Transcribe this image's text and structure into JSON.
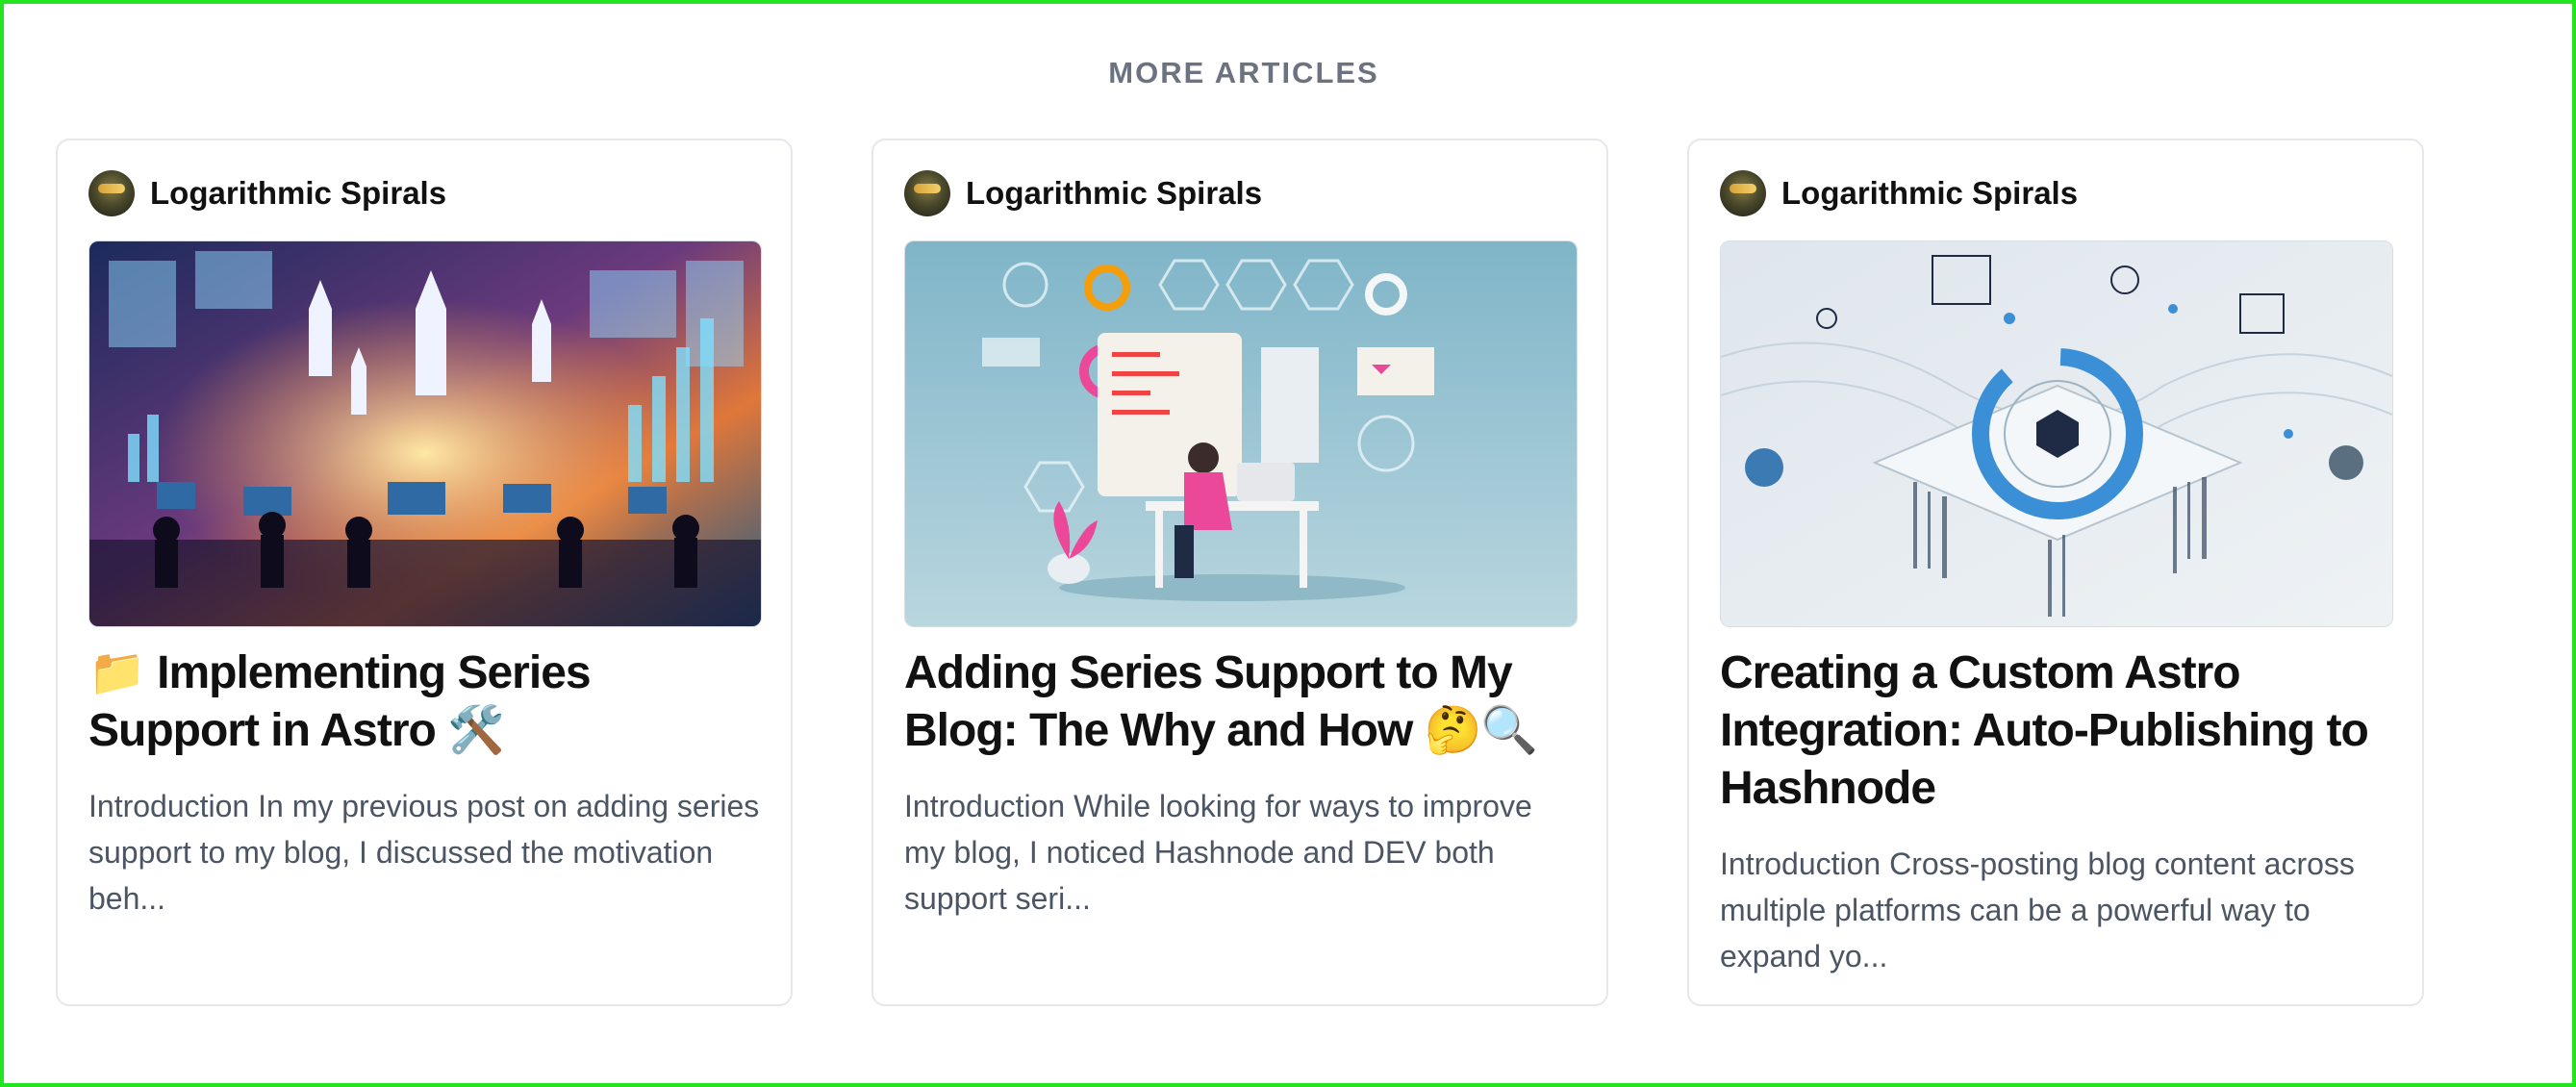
{
  "section": {
    "title": "MORE ARTICLES"
  },
  "articles": [
    {
      "author": "Logarithmic Spirals",
      "title": "📁 Implementing Series Support in Astro 🛠️",
      "excerpt": "Introduction In my previous post on adding series support to my blog, I discussed the motivation beh...",
      "image_icon": "rocket-launch-developers-illustration"
    },
    {
      "author": "Logarithmic Spirals",
      "title": "Adding Series Support to My Blog: The Why and How 🤔🔍",
      "excerpt": "Introduction While looking for ways to improve my blog, I noticed Hashnode and DEV both support seri...",
      "image_icon": "developer-at-desk-illustration"
    },
    {
      "author": "Logarithmic Spirals",
      "title": "Creating a Custom Astro Integration: Auto-Publishing to Hashnode",
      "excerpt": "Introduction Cross-posting blog content across multiple platforms can be a powerful way to expand yo...",
      "image_icon": "integration-platform-illustration"
    }
  ],
  "colors": {
    "border": "#e5e7eb",
    "section_title": "#6b7280",
    "frame": "#22e41f"
  }
}
